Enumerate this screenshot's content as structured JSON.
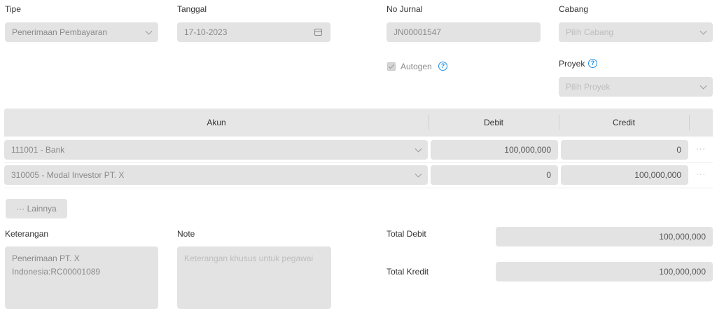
{
  "header": {
    "tipe": {
      "label": "Tipe",
      "value": "Penerimaan Pembayaran"
    },
    "tanggal": {
      "label": "Tanggal",
      "value": "17-10-2023"
    },
    "no_jurnal": {
      "label": "No Jurnal",
      "value": "JN00001547"
    },
    "cabang": {
      "label": "Cabang",
      "placeholder": "Pilih Cabang"
    },
    "autogen": {
      "label": "Autogen",
      "checked": true
    },
    "proyek": {
      "label": "Proyek",
      "placeholder": "Pilih Proyek"
    }
  },
  "table": {
    "columns": [
      "Akun",
      "Debit",
      "Credit"
    ],
    "rows": [
      {
        "akun": "111001 - Bank",
        "debit": "100,000,000",
        "credit": "0"
      },
      {
        "akun": "310005 - Modal Investor PT. X",
        "debit": "0",
        "credit": "100,000,000"
      }
    ],
    "more_label": "··· Lainnya"
  },
  "footer": {
    "keterangan": {
      "label": "Keterangan",
      "line1": "Penerimaan PT. X",
      "line2": "Indonesia:RC00001089"
    },
    "note": {
      "label": "Note",
      "placeholder": "Keterangan khusus untuk pegawai"
    },
    "total_debit": {
      "label": "Total Debit",
      "value": "100,000,000"
    },
    "total_kredit": {
      "label": "Total Kredit",
      "value": "100,000,000"
    }
  },
  "icons": {
    "help": "?",
    "row_menu": "···"
  },
  "colors": {
    "field_bg": "#e3e3e3",
    "help_blue": "#1e90e6"
  }
}
